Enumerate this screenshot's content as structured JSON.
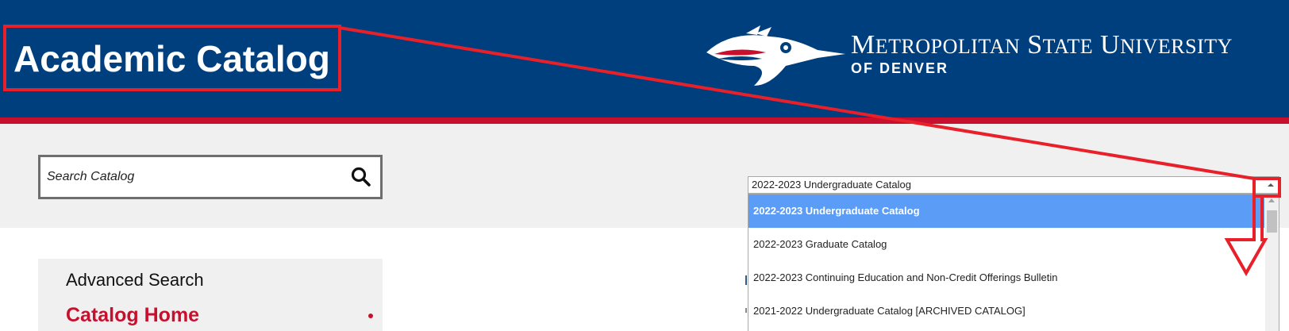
{
  "header": {
    "title": "Academic Catalog",
    "university_name_words": [
      {
        "initial": "M",
        "rest": "ETROPOLITAN"
      },
      {
        "initial": "S",
        "rest": "TATE"
      },
      {
        "initial": "U",
        "rest": "NIVERSITY"
      }
    ],
    "university_subtitle": "OF DENVER",
    "logo_icon": "roadrunner-logo-icon"
  },
  "search": {
    "placeholder": "Search Catalog",
    "value": "",
    "icon": "search-icon"
  },
  "catalog_select": {
    "selected": "2022-2023 Undergraduate Catalog",
    "options": [
      "2022-2023 Undergraduate Catalog",
      "2022-2023 Graduate Catalog",
      "2022-2023 Continuing Education and Non-Credit Offerings Bulletin",
      "2021-2022 Undergraduate Catalog [ARCHIVED CATALOG]"
    ],
    "highlighted_index": 0
  },
  "sidebar": {
    "advanced_search": "Advanced Search",
    "catalog_home": "Catalog Home"
  },
  "colors": {
    "header_bg": "#003f7d",
    "accent_red": "#c8102e",
    "toolbar_bg": "#f0f0f0",
    "selected_option": "#5b9cf6",
    "annotation": "#e8202a"
  }
}
